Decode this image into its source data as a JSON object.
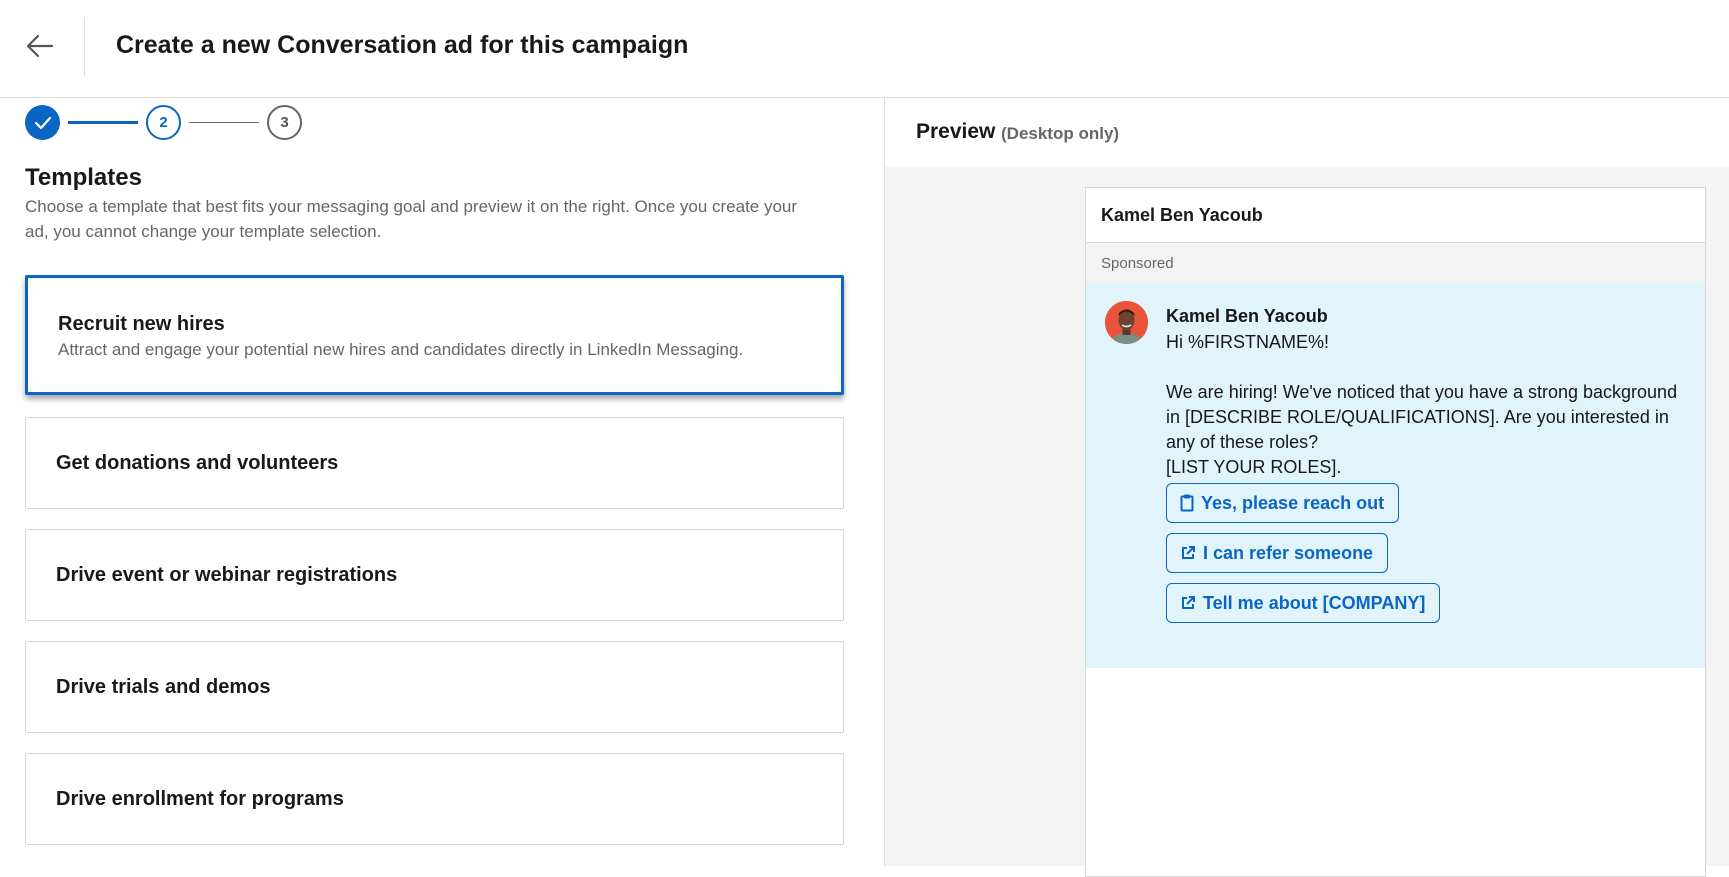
{
  "header": {
    "title": "Create a new Conversation ad for this campaign"
  },
  "stepper": {
    "current_step": "2",
    "next_step": "3"
  },
  "templates": {
    "heading": "Templates",
    "description": "Choose a template that best fits your messaging goal and preview it on the right. Once you create your ad, you cannot change your template selection.",
    "items": [
      {
        "title": "Recruit new hires",
        "description": "Attract and engage your potential new hires and candidates directly in LinkedIn Messaging.",
        "selected": true
      },
      {
        "title": "Get donations and volunteers"
      },
      {
        "title": "Drive event or webinar registrations"
      },
      {
        "title": "Drive trials and demos"
      },
      {
        "title": "Drive enrollment for programs"
      }
    ]
  },
  "preview": {
    "title": "Preview",
    "subtitle": "(Desktop only)",
    "card_header_name": "Kamel Ben Yacoub",
    "sponsored_label": "Sponsored",
    "sender_name": "Kamel Ben Yacoub",
    "message_lines": [
      "Hi %FIRSTNAME%!",
      "",
      "We are hiring! We've noticed that you have a strong background in [DESCRIBE ROLE/QUALIFICATIONS]. Are you interested in any of these roles?",
      "[LIST YOUR ROLES]."
    ],
    "buttons": [
      {
        "label": "Yes, please reach out",
        "icon": "clipboard-icon"
      },
      {
        "label": "I can refer someone",
        "icon": "external-link-icon"
      },
      {
        "label": "Tell me about [COMPANY]",
        "icon": "external-link-icon"
      }
    ]
  },
  "colors": {
    "accent": "#0a66c2",
    "preview_message_bg": "#e1f3fb",
    "avatar_bg": "#e8533a"
  }
}
